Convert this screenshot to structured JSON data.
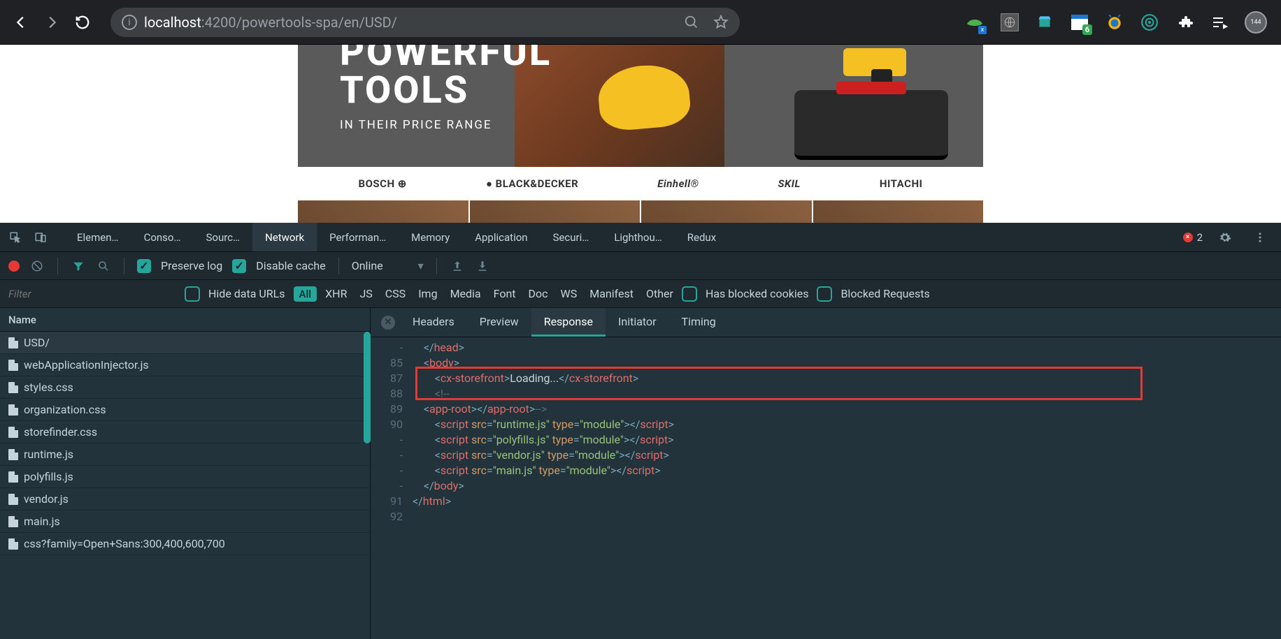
{
  "browser": {
    "url_host": "localhost",
    "url_path": ":4200/powertools-spa/en/USD/",
    "avatar_badge": "144",
    "ext_badge_green": "6"
  },
  "page": {
    "hero_line1": "POWERFUL",
    "hero_line2": "TOOLS",
    "hero_sub": "IN THEIR PRICE RANGE",
    "brands": [
      "BOSCH ⊕",
      "● BLACK&DECKER",
      "Einhell®",
      "SKIL",
      "HITACHI"
    ]
  },
  "devtools": {
    "tabs": [
      "Elemen…",
      "Conso…",
      "Sourc…",
      "Network",
      "Performan…",
      "Memory",
      "Application",
      "Securi…",
      "Lighthou…",
      "Redux"
    ],
    "active_tab": "Network",
    "error_count": "2",
    "toolbar": {
      "preserve_log": "Preserve log",
      "disable_cache": "Disable cache",
      "throttling": "Online"
    },
    "filter": {
      "placeholder": "Filter",
      "hide_data_urls": "Hide data URLs",
      "all": "All",
      "types": [
        "XHR",
        "JS",
        "CSS",
        "Img",
        "Media",
        "Font",
        "Doc",
        "WS",
        "Manifest",
        "Other"
      ],
      "blocked_cookies_label": "Has blocked cookies",
      "blocked_requests_label": "Blocked Requests"
    },
    "request_list": {
      "header": "Name",
      "items": [
        "USD/",
        "webApplicationInjector.js",
        "styles.css",
        "organization.css",
        "storefinder.css",
        "runtime.js",
        "polyfills.js",
        "vendor.js",
        "main.js",
        "css?family=Open+Sans:300,400,600,700"
      ]
    },
    "response": {
      "tabs": [
        "Headers",
        "Preview",
        "Response",
        "Initiator",
        "Timing"
      ],
      "active_tab": "Response",
      "lines": [
        {
          "n": "-",
          "html": "    <span class='tag-punc'>&lt;/</span><span class='tag-name'>head</span><span class='tag-punc'>&gt;</span>"
        },
        {
          "n": "85",
          "html": "    <span class='tag-punc'>&lt;</span><span class='tag-name'>body</span><span class='tag-punc'>&gt;</span>"
        },
        {
          "n": "87",
          "html": "        <span class='tag-punc'>&lt;</span><span class='tag-name'>cx-storefront</span><span class='tag-punc'>&gt;</span><span class='tag-txt'>Loading...</span><span class='tag-punc'>&lt;/</span><span class='tag-name'>cx-storefront</span><span class='tag-punc'>&gt;</span>"
        },
        {
          "n": "88",
          "html": "        <span class='tag-cm'>&lt;!--</span>"
        },
        {
          "n": "89",
          "html": "    <span class='tag-punc'>&lt;</span><span class='tag-name'>app-root</span><span class='tag-punc'>&gt;</span><span class='tag-punc'>&lt;/</span><span class='tag-name'>app-root</span><span class='tag-punc'>&gt;</span><span class='tag-cm'>--&gt;</span>"
        },
        {
          "n": "90",
          "html": "        <span class='tag-punc'>&lt;</span><span class='tag-name'>script</span> <span class='tag-attr'>src</span><span class='tag-punc'>=</span><span class='tag-str'>\"runtime.js\"</span> <span class='tag-attr'>type</span><span class='tag-punc'>=</span><span class='tag-str'>\"module\"</span><span class='tag-punc'>&gt;&lt;/</span><span class='tag-name'>script</span><span class='tag-punc'>&gt;</span>"
        },
        {
          "n": "-",
          "html": "        <span class='tag-punc'>&lt;</span><span class='tag-name'>script</span> <span class='tag-attr'>src</span><span class='tag-punc'>=</span><span class='tag-str'>\"polyfills.js\"</span> <span class='tag-attr'>type</span><span class='tag-punc'>=</span><span class='tag-str'>\"module\"</span><span class='tag-punc'>&gt;&lt;/</span><span class='tag-name'>script</span><span class='tag-punc'>&gt;</span>"
        },
        {
          "n": "-",
          "html": "        <span class='tag-punc'>&lt;</span><span class='tag-name'>script</span> <span class='tag-attr'>src</span><span class='tag-punc'>=</span><span class='tag-str'>\"vendor.js\"</span> <span class='tag-attr'>type</span><span class='tag-punc'>=</span><span class='tag-str'>\"module\"</span><span class='tag-punc'>&gt;&lt;/</span><span class='tag-name'>script</span><span class='tag-punc'>&gt;</span>"
        },
        {
          "n": "-",
          "html": "        <span class='tag-punc'>&lt;</span><span class='tag-name'>script</span> <span class='tag-attr'>src</span><span class='tag-punc'>=</span><span class='tag-str'>\"main.js\"</span> <span class='tag-attr'>type</span><span class='tag-punc'>=</span><span class='tag-str'>\"module\"</span><span class='tag-punc'>&gt;&lt;/</span><span class='tag-name'>script</span><span class='tag-punc'>&gt;</span>"
        },
        {
          "n": "-",
          "html": "    <span class='tag-punc'>&lt;/</span><span class='tag-name'>body</span><span class='tag-punc'>&gt;</span>"
        },
        {
          "n": "91",
          "html": "<span class='tag-punc'>&lt;/</span><span class='tag-name'>html</span><span class='tag-punc'>&gt;</span>"
        },
        {
          "n": "92",
          "html": ""
        }
      ]
    }
  }
}
